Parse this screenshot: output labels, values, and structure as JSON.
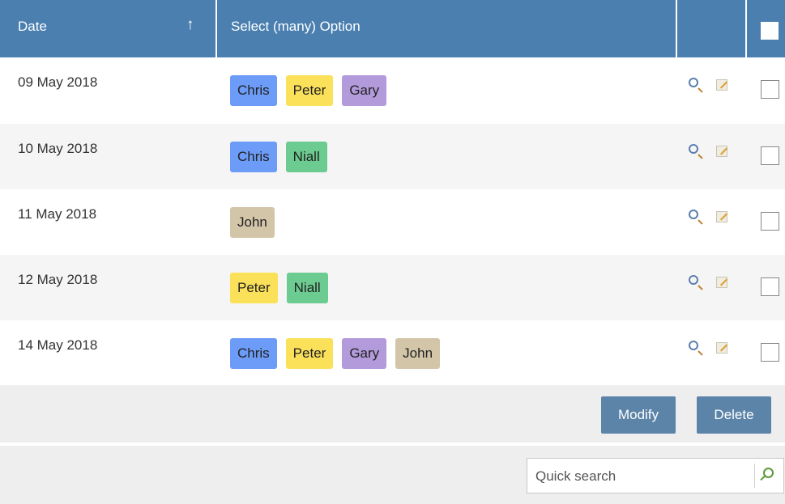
{
  "table": {
    "headers": {
      "date": "Date",
      "sort_arrow": "↑",
      "select": "Select (many) Option"
    },
    "rows": [
      {
        "date": "09 May 2018",
        "tags": [
          "Chris",
          "Peter",
          "Gary"
        ]
      },
      {
        "date": "10 May 2018",
        "tags": [
          "Chris",
          "Niall"
        ]
      },
      {
        "date": "11 May 2018",
        "tags": [
          "John"
        ]
      },
      {
        "date": "12 May 2018",
        "tags": [
          "Peter",
          "Niall"
        ]
      },
      {
        "date": "14 May 2018",
        "tags": [
          "Chris",
          "Peter",
          "Gary",
          "John"
        ]
      }
    ]
  },
  "tag_colors": {
    "Chris": "#6c9cf7",
    "Peter": "#fbe15a",
    "Gary": "#b39adb",
    "Niall": "#6ccb90",
    "John": "#d3c6a8"
  },
  "icons": {
    "view": "magnifier-icon",
    "edit": "edit-icon",
    "search": "search-icon"
  },
  "actions": {
    "modify": "Modify",
    "delete": "Delete"
  },
  "search": {
    "placeholder": "Quick search",
    "value": ""
  }
}
